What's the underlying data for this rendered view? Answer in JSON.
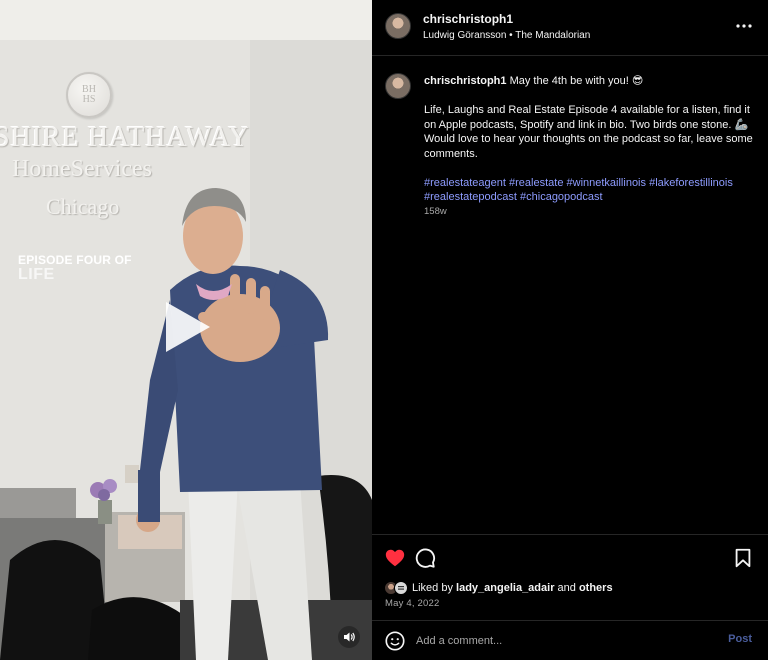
{
  "media": {
    "logo_monogram_top": "BH",
    "logo_monogram_bottom": "HS",
    "brand_line1": "SHIRE HATHAWAY",
    "brand_line2": "HomeServices",
    "brand_line3": "Chicago",
    "episode_title": "EPISODE FOUR OF",
    "episode_subtitle": "LIFE",
    "play_icon": "play-icon",
    "mute_icon": "speaker-icon"
  },
  "header": {
    "username": "chrischristoph1",
    "audio": "Ludwig Göransson • The Mandalorian",
    "more_icon": "more-horizontal-icon"
  },
  "caption": {
    "username": "chrischristoph1",
    "first_line": " May the 4th be with you! 😎",
    "body": "Life, Laughs and Real Estate Episode 4 available for a listen, find it on Apple podcasts, Spotify and link in bio. Two birds one stone. 🦾 Would love to hear your thoughts on the podcast so far, leave some comments.",
    "hashtags": [
      "#realestateagent",
      "#realestate",
      "#winnetkaillinois",
      "#lakeforestillinois",
      "#realestatepodcast",
      "#chicagopodcast"
    ],
    "time_ago": "158w"
  },
  "actions": {
    "like_icon": "heart-filled-icon",
    "comment_icon": "comment-icon",
    "save_icon": "bookmark-icon",
    "liked_prefix": "Liked by ",
    "liked_user": "lady_angelia_adair",
    "liked_and": " and ",
    "liked_others": "others",
    "date": "May 4, 2022"
  },
  "comment": {
    "emoji_icon": "emoji-icon",
    "placeholder": "Add a comment...",
    "post_label": "Post"
  },
  "colors": {
    "background": "#000000",
    "text": "#f5f5f5",
    "muted": "#a8a8a8",
    "hashtag": "#8e9cff",
    "like": "#ff3040",
    "post_button": "#4a5d9c"
  }
}
